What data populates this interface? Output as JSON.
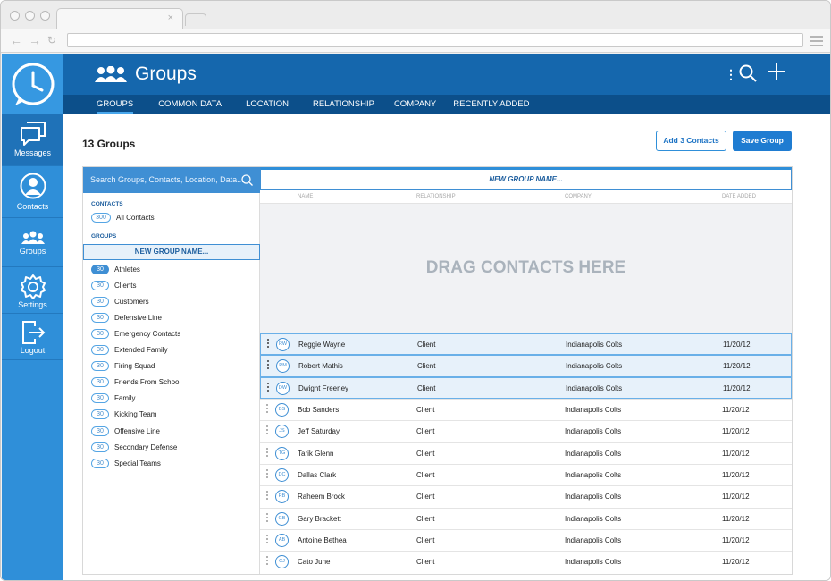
{
  "app": {
    "title": "Groups",
    "tabs": [
      {
        "label": "GROUPS",
        "active": true
      },
      {
        "label": "COMMON DATA",
        "active": false
      },
      {
        "label": "LOCATION",
        "active": false
      },
      {
        "label": "RELATIONSHIP",
        "active": false
      },
      {
        "label": "COMPANY",
        "active": false
      },
      {
        "label": "RECENTLY ADDED",
        "active": false
      }
    ]
  },
  "sidebar": {
    "items": [
      {
        "label": "Messages",
        "icon": "chat-icon",
        "active": true
      },
      {
        "label": "Contacts",
        "icon": "person-icon",
        "active": false
      },
      {
        "label": "Groups",
        "icon": "groups-icon",
        "active": false
      },
      {
        "label": "Settings",
        "icon": "gear-icon",
        "active": false
      },
      {
        "label": "Logout",
        "icon": "logout-icon",
        "active": false
      }
    ]
  },
  "header": {
    "more_icon": "vertical-ellipsis-icon",
    "search_icon": "search-icon",
    "add_icon": "plus-icon"
  },
  "main": {
    "count_title": "13 Groups",
    "add_contacts_label": "Add 3 Contacts",
    "save_group_label": "Save Group"
  },
  "left": {
    "search_placeholder": "Search Groups, Contacts, Location, Data...",
    "contacts_label": "CONTACTS",
    "all_contacts": {
      "count": "300",
      "label": "All Contacts"
    },
    "groups_label": "GROUPS",
    "new_group_label": "NEW GROUP NAME...",
    "groups": [
      {
        "count": "30",
        "label": "Athletes",
        "selected": true
      },
      {
        "count": "30",
        "label": "Clients",
        "selected": false
      },
      {
        "count": "30",
        "label": "Customers",
        "selected": false
      },
      {
        "count": "30",
        "label": "Defensive Line",
        "selected": false
      },
      {
        "count": "30",
        "label": "Emergency Contacts",
        "selected": false
      },
      {
        "count": "30",
        "label": "Extended Family",
        "selected": false
      },
      {
        "count": "30",
        "label": "Firing Squad",
        "selected": false
      },
      {
        "count": "30",
        "label": "Friends From School",
        "selected": false
      },
      {
        "count": "30",
        "label": "Family",
        "selected": false
      },
      {
        "count": "30",
        "label": "Kicking Team",
        "selected": false
      },
      {
        "count": "30",
        "label": "Offensive Line",
        "selected": false
      },
      {
        "count": "30",
        "label": "Secondary Defense",
        "selected": false
      },
      {
        "count": "30",
        "label": "Special Teams",
        "selected": false
      }
    ]
  },
  "right": {
    "new_group_placeholder": "NEW GROUP NAME...",
    "columns": [
      "NAME",
      "RELATIONSHIP",
      "COMPANY",
      "DATE ADDED"
    ],
    "drop_text": "DRAG CONTACTS HERE",
    "contacts": [
      {
        "initials": "RW",
        "name": "Reggie Wayne",
        "relationship": "Client",
        "company": "Indianapolis Colts",
        "date": "11/20/12",
        "selected": true
      },
      {
        "initials": "RM",
        "name": "Robert Mathis",
        "relationship": "Client",
        "company": "Indianapolis Colts",
        "date": "11/20/12",
        "selected": true
      },
      {
        "initials": "DW",
        "name": "Dwight Freeney",
        "relationship": "Client",
        "company": "Indianapolis Colts",
        "date": "11/20/12",
        "selected": true
      },
      {
        "initials": "BS",
        "name": "Bob Sanders",
        "relationship": "Client",
        "company": "Indianapolis Colts",
        "date": "11/20/12",
        "selected": false
      },
      {
        "initials": "JS",
        "name": "Jeff Saturday",
        "relationship": "Client",
        "company": "Indianapolis Colts",
        "date": "11/20/12",
        "selected": false
      },
      {
        "initials": "TG",
        "name": "Tarik Glenn",
        "relationship": "Client",
        "company": "Indianapolis Colts",
        "date": "11/20/12",
        "selected": false
      },
      {
        "initials": "DC",
        "name": "Dallas Clark",
        "relationship": "Client",
        "company": "Indianapolis Colts",
        "date": "11/20/12",
        "selected": false
      },
      {
        "initials": "RB",
        "name": "Raheem Brock",
        "relationship": "Client",
        "company": "Indianapolis Colts",
        "date": "11/20/12",
        "selected": false
      },
      {
        "initials": "GB",
        "name": "Gary Brackett",
        "relationship": "Client",
        "company": "Indianapolis Colts",
        "date": "11/20/12",
        "selected": false
      },
      {
        "initials": "AB",
        "name": "Antoine Bethea",
        "relationship": "Client",
        "company": "Indianapolis Colts",
        "date": "11/20/12",
        "selected": false
      },
      {
        "initials": "CJ",
        "name": "Cato June",
        "relationship": "Client",
        "company": "Indianapolis Colts",
        "date": "11/20/12",
        "selected": false
      }
    ]
  },
  "colors": {
    "sidebar": "#2f8fd9",
    "header": "#1567ad",
    "subnav": "#0c4f8a",
    "accent": "#3f8fd4",
    "selected_row": "#e7f1fa"
  }
}
